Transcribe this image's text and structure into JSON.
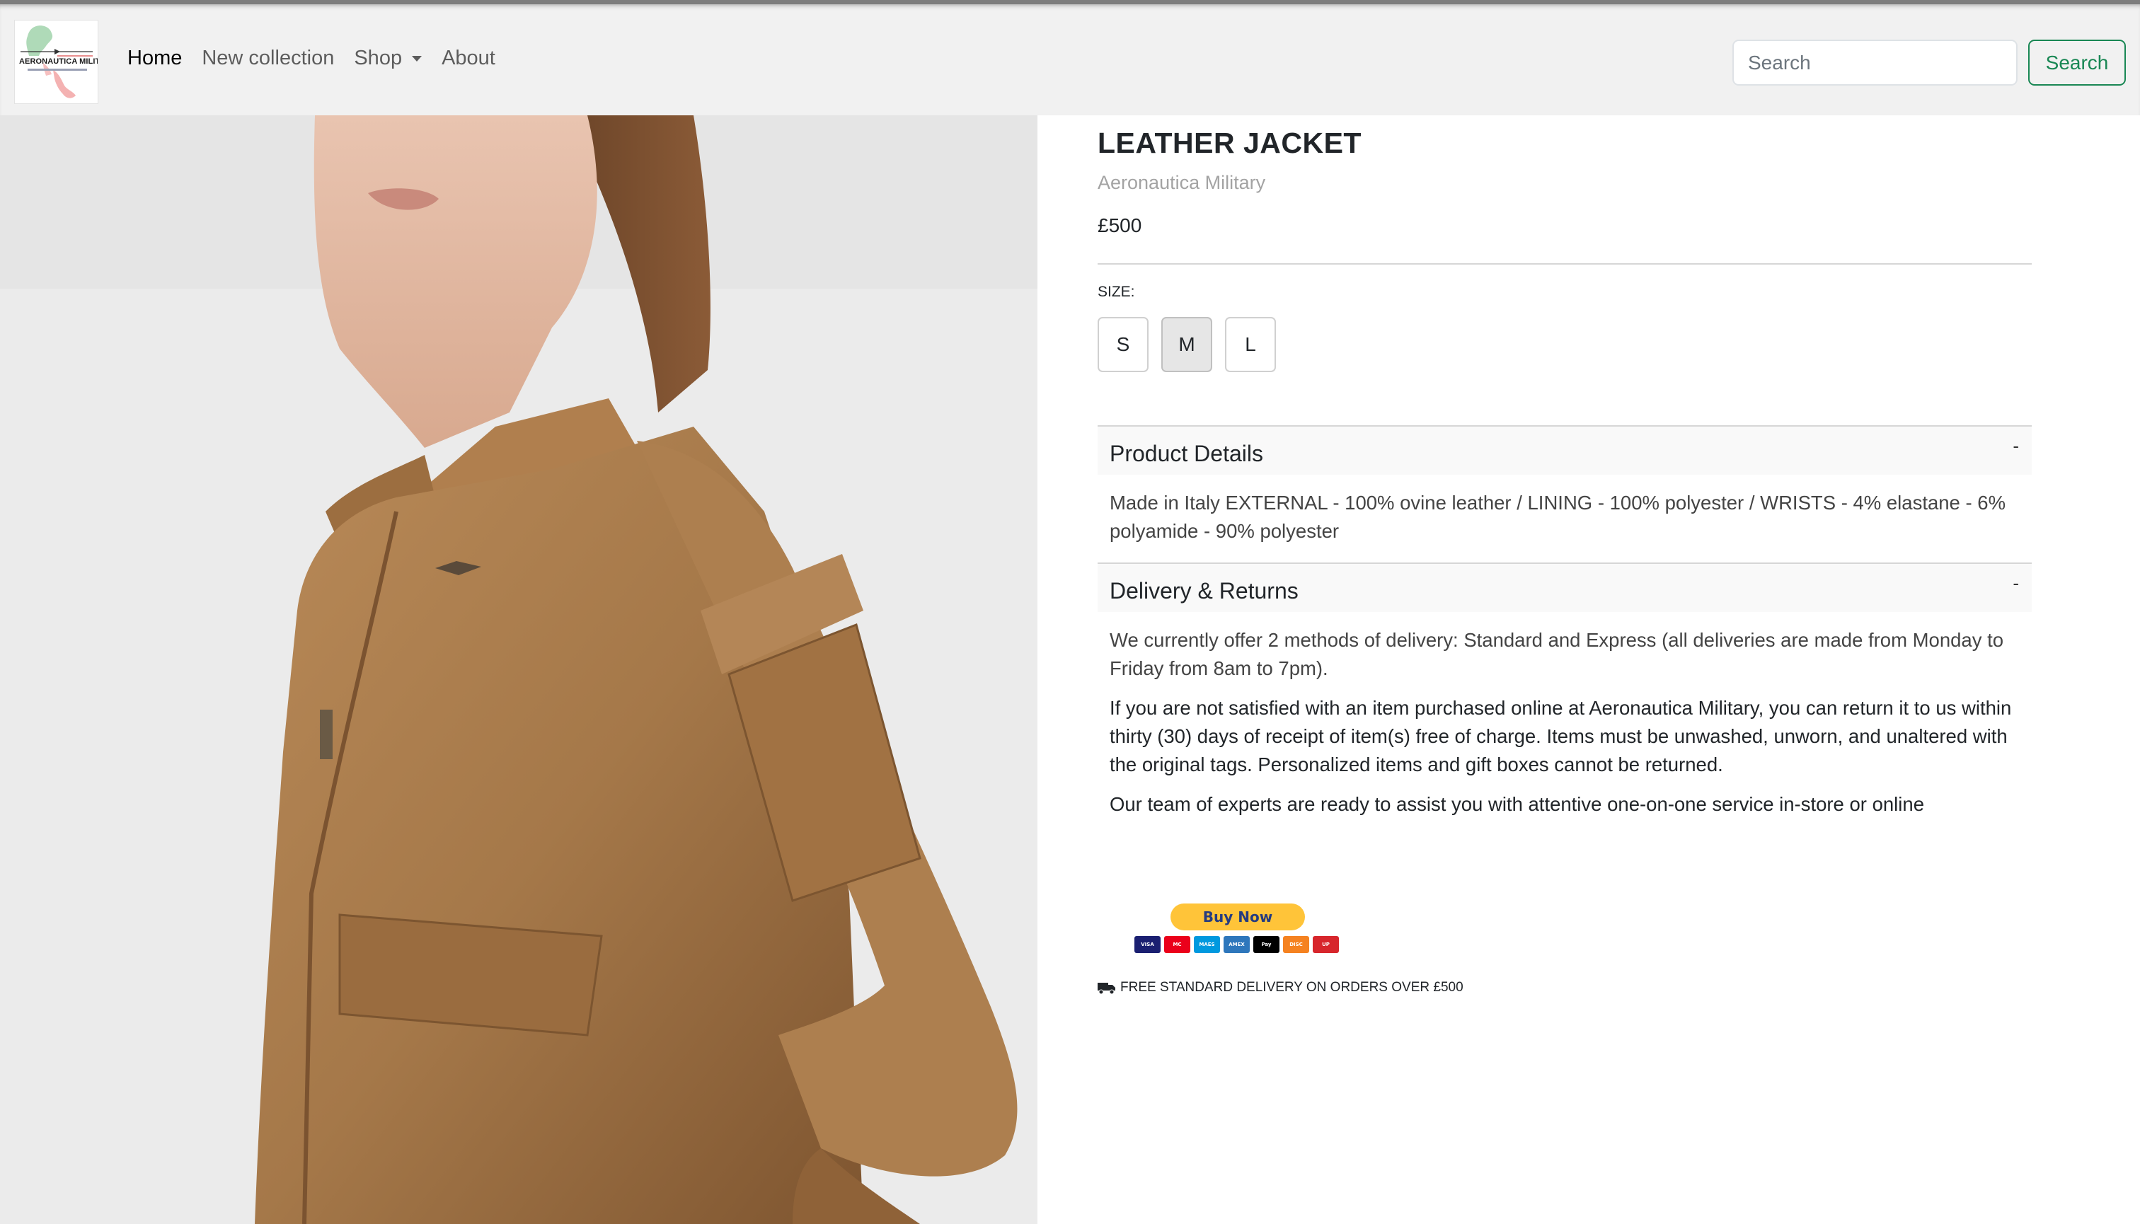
{
  "navbar": {
    "logo_text": "AERONAUTICA MILITARY",
    "links": [
      {
        "label": "Home",
        "active": true
      },
      {
        "label": "New collection",
        "active": false
      },
      {
        "label": "Shop",
        "active": false
      },
      {
        "label": "About",
        "active": false
      }
    ],
    "search": {
      "placeholder": "Search",
      "button_label": "Search"
    }
  },
  "product": {
    "image_alt": "Woman wearing a tan brown leather jacket",
    "title": "LEATHER JACKET",
    "brand": "Aeronautica Military",
    "price": "£500",
    "size_label": "SIZE:",
    "sizes": [
      {
        "label": "S",
        "selected": false
      },
      {
        "label": "M",
        "selected": true
      },
      {
        "label": "L",
        "selected": false
      }
    ]
  },
  "accordion": {
    "product_details": {
      "title": "Product Details",
      "toggle": "-",
      "body": "Made in Italy EXTERNAL - 100% ovine leather / LINING - 100% polyester / WRISTS - 4% elastane - 6% polyamide - 90% polyester"
    },
    "delivery_returns": {
      "title": "Delivery & Returns",
      "toggle": "-",
      "paragraphs": [
        "We currently offer 2 methods of delivery: Standard and Express (all deliveries are made from Monday to Friday from 8am to 7pm).",
        "If you are not satisfied with an item purchased online at Aeronautica Military, you can return it to us within thirty (30) days of receipt of item(s) free of charge. Items must be unwashed, unworn, and unaltered with the original tags. Personalized items and gift boxes cannot be returned.",
        "Our team of experts are ready to assist you with attentive one-on-one service in-store or online"
      ]
    }
  },
  "checkout": {
    "buy_now_label": "Buy Now",
    "cards": [
      {
        "label": "VISA",
        "color": "#1a1f71"
      },
      {
        "label": "MC",
        "color": "#eb001b"
      },
      {
        "label": "MAES",
        "color": "#0099df"
      },
      {
        "label": "AMEX",
        "color": "#2e77bc"
      },
      {
        "label": "Pay",
        "color": "#000000"
      },
      {
        "label": "DISC",
        "color": "#f58220"
      },
      {
        "label": "UP",
        "color": "#d7262c"
      }
    ]
  },
  "shipping": {
    "icon": "truck-icon",
    "text": "FREE STANDARD DELIVERY ON ORDERS OVER £500"
  },
  "colors": {
    "accent_green": "#198754",
    "paypal_yellow": "#ffc439",
    "leather": "#a57849"
  }
}
